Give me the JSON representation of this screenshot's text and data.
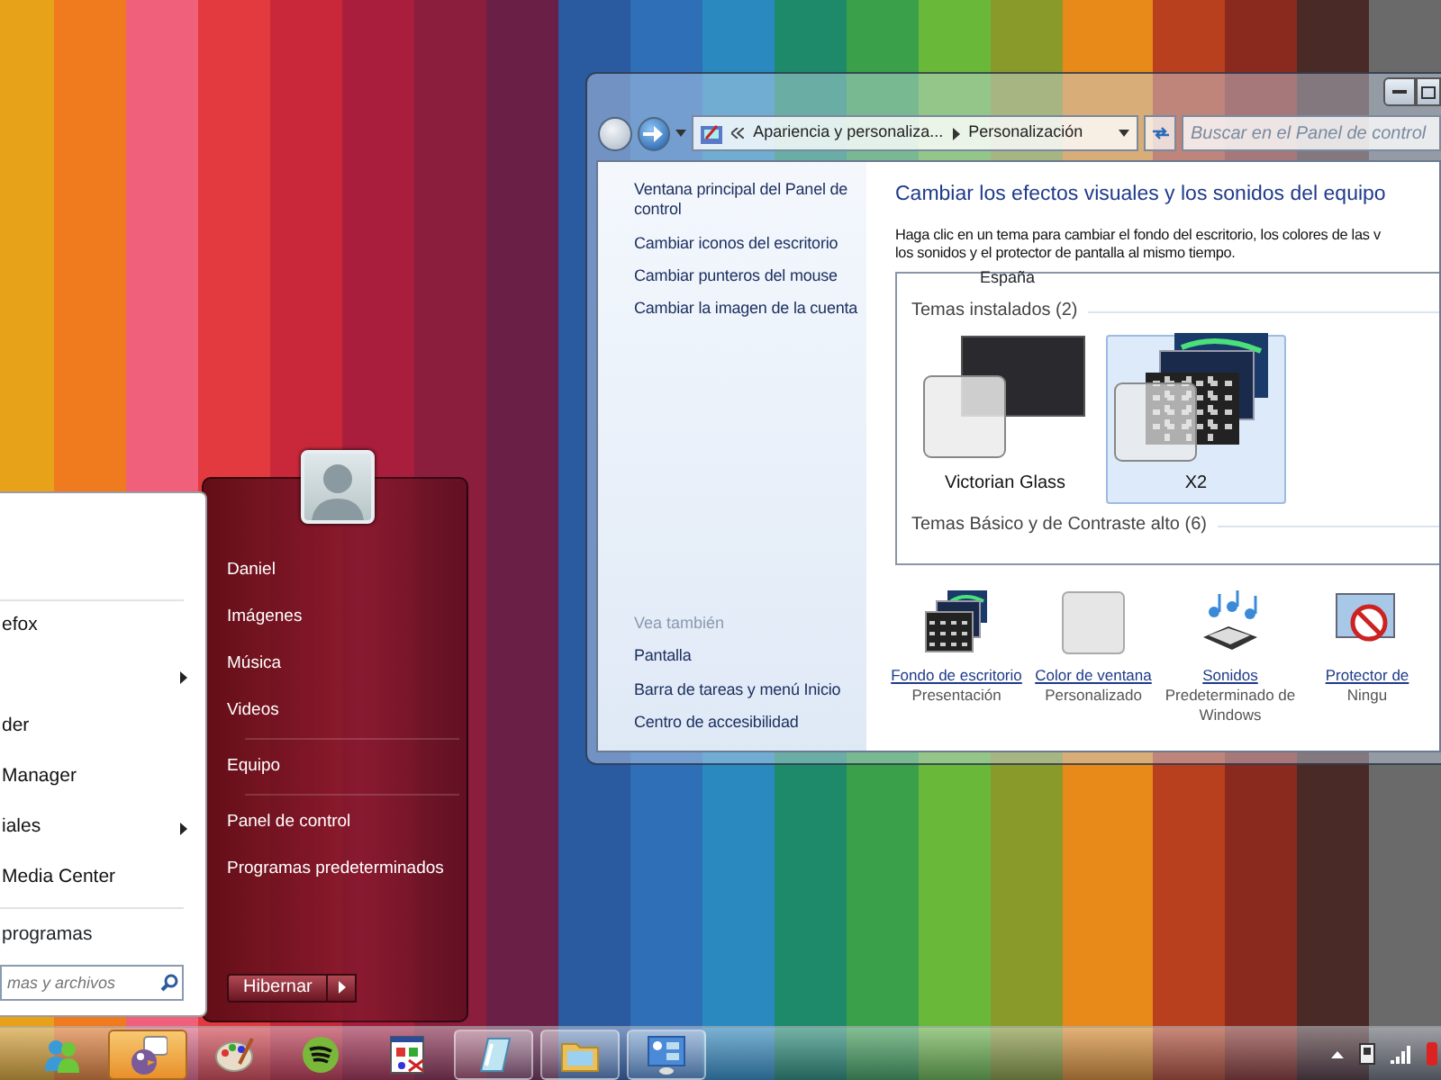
{
  "control_panel": {
    "breadcrumbs": [
      "Apariencia y personaliza...",
      "Personalización"
    ],
    "search": {
      "placeholder": "Buscar en el Panel de control"
    },
    "sidebar": {
      "links": [
        "Ventana principal del Panel de control",
        "Cambiar iconos del escritorio",
        "Cambiar punteros del mouse",
        "Cambiar la imagen de la cuenta"
      ],
      "see_also_heading": "Vea también",
      "see_also": [
        "Pantalla",
        "Barra de tareas y menú Inicio",
        "Centro de accesibilidad"
      ]
    },
    "heading": "Cambiar los efectos visuales y los sonidos del equipo",
    "description_lines": [
      "Haga clic en un tema para cambiar el fondo del escritorio, los colores de las v",
      "los sonidos y el protector de pantalla al mismo tiempo."
    ],
    "theme_list": {
      "cut_label": "España",
      "installed_heading": "Temas instalados (2)",
      "installed": [
        {
          "name": "Victorian Glass",
          "kind": "dark",
          "selected": false
        },
        {
          "name": "X2",
          "kind": "aurora",
          "selected": true
        }
      ],
      "basic_heading": "Temas Básico y de Contraste alto (6)"
    },
    "settings": [
      {
        "kind": "wallpaper",
        "label": "Fondo de escritorio",
        "value": "Presentación"
      },
      {
        "kind": "color",
        "label": "Color de ventana",
        "value": "Personalizado"
      },
      {
        "kind": "sounds",
        "label": "Sonidos",
        "value": "Predeterminado de Windows"
      },
      {
        "kind": "screensaver",
        "label": "Protector de",
        "value": "Ningu"
      }
    ]
  },
  "start_menu": {
    "programs": [
      {
        "label": "efox",
        "submenu": false
      },
      {
        "submenu": true
      },
      {
        "label": "der",
        "submenu": false
      },
      {
        "label": "Manager",
        "submenu": false
      },
      {
        "label": "iales",
        "submenu": true
      },
      {
        "label": "Media Center",
        "submenu": false
      }
    ],
    "all_programs": "programas",
    "search": {
      "placeholder": "mas y archivos"
    },
    "place_groups": [
      [
        "Daniel",
        "Imágenes",
        "Música",
        "Videos"
      ],
      [
        "Equipo"
      ],
      [
        "Panel de control",
        "Programas predeterminados"
      ]
    ],
    "shutdown": "Hibernar"
  },
  "taskbar": {
    "buttons": [
      {
        "kind": "people",
        "open": false,
        "highlighted": false
      },
      {
        "kind": "chat",
        "open": false,
        "highlighted": true
      },
      {
        "kind": "paint",
        "open": false,
        "highlighted": false
      },
      {
        "kind": "music",
        "open": false,
        "highlighted": false
      },
      {
        "kind": "image-editor",
        "open": false,
        "highlighted": false
      },
      {
        "kind": "notepad",
        "open": true,
        "highlighted": false
      },
      {
        "kind": "folder",
        "open": true,
        "highlighted": false
      },
      {
        "kind": "control-panel",
        "open": true,
        "highlighted": false
      }
    ]
  }
}
